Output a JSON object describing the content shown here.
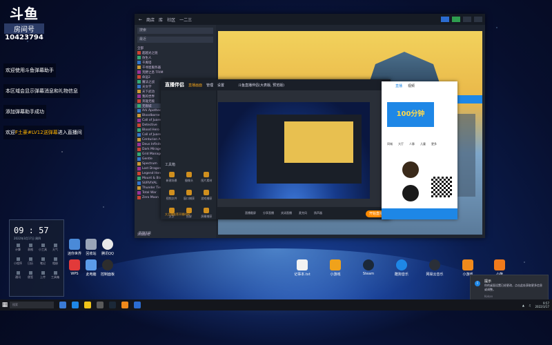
{
  "overlay": {
    "logo": {
      "glyph": "斗鱼",
      "room_label": "房间号",
      "room_number": "10423794"
    },
    "chat": [
      {
        "text": "欢迎使用斗鱼弹幕助手"
      },
      {
        "text": "本区域会显示弹幕消息和礼物信息"
      },
      {
        "text": "添加弹幕助手成功"
      },
      {
        "prefix": "欢迎",
        "name": "F土豪#LV12送弹幕",
        "suffix": "进入直播间"
      }
    ]
  },
  "main_window": {
    "nav": [
      "商店",
      "库",
      "社区",
      "一二三"
    ],
    "search_placeholder": "搜索",
    "filter": "最近",
    "section": "全部",
    "games": [
      "超越光之链",
      "仿生人",
      "千库塔",
      "千寻屋服务器",
      "荒野之息 TRIM",
      "命运2",
      "魔法之战",
      "天文学",
      "天下武功",
      "我的世界",
      "英雄无敌",
      "无限城",
      "Ark Apotheosis",
      "Bloodborne",
      "Call of Juarez",
      "Detective",
      "Blood Hero",
      "Call of Juarez 2",
      "Centurion Age",
      "Deus Infinite",
      "Dark Mirage",
      "Grid Manager",
      "Gentle",
      "Spectrum",
      "Lost Dragon",
      "Legend Hero",
      "Mount & Blade",
      "SURVIVAL",
      "Thunder Tier",
      "Total War",
      "Zero Moon"
    ],
    "add_game": "添加游戏",
    "manage": "管理下载"
  },
  "capture_window": {
    "brand": "直播伴侣",
    "menu": [
      "直播画面",
      "管理",
      "设置"
    ],
    "title": "斗鱼直播伴侣(大表版, 预览版)",
    "tools_label": "工具箱",
    "tools": [
      "新建场景",
      "摄像头",
      "图片素材",
      "视频文件",
      "窗口捕获",
      "游戏捕获",
      "文字",
      "投屏",
      "屏幕捕获"
    ],
    "toolbar": [
      "直播截屏",
      "分享直播",
      "关闭直播",
      "麦克风",
      "扬声器"
    ],
    "go_live": "开始直播",
    "notice": "大主播推荐开播时间"
  },
  "web_window": {
    "tabs": [
      "直播",
      "视频"
    ],
    "promo": "100分钟",
    "nav": [
      "同城",
      "大厅",
      "人脉",
      "儿童",
      "更多"
    ]
  },
  "clock": {
    "time": "09 : 57",
    "date": "2022年3月17日 周四",
    "items": [
      "计算",
      "表格",
      "小工具",
      "天气",
      "小程序",
      "日历",
      "笔记",
      "相册",
      "通讯",
      "便签",
      "上传",
      "工具箱"
    ]
  },
  "desktop_icons": [
    "迷你世界",
    "回收站",
    "腾讯QQ",
    "WPS",
    "此电脑",
    "控制面板",
    "记事本.txt",
    "小游戏",
    "Steam",
    "酷狗音乐",
    "网易云音乐",
    "小游戏",
    "小熊"
  ],
  "toast": {
    "title": "提示",
    "body": "你的桌面设置已经更改，点击此处获取更多信息或调整。",
    "app": "Kokan"
  },
  "taskbar": {
    "search": "搜索",
    "time": "9:57",
    "date": "2022/3/17"
  }
}
